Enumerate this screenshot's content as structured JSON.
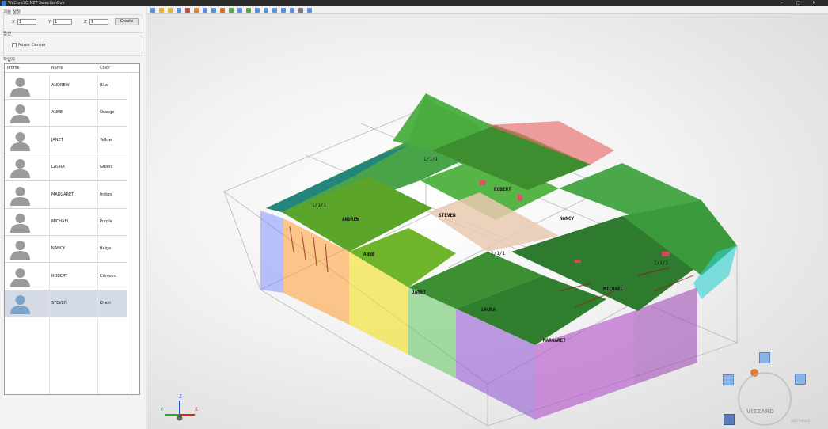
{
  "window": {
    "title": "VizCore3D.NET SelectionBox",
    "min": "–",
    "max": "▢",
    "close": "✕"
  },
  "sidebar": {
    "group_basic": "기본 설정",
    "x_label": "X",
    "x_value": "1",
    "y_label": "Y",
    "y_value": "1",
    "z_label": "Z",
    "z_value": "1",
    "create_button": "Create",
    "group_option": "옵션",
    "move_center": "Move Center",
    "group_workers": "작업자",
    "columns": [
      "Profile",
      "Name",
      "Color"
    ],
    "workers": [
      {
        "name": "ANDREW",
        "color": "Blue"
      },
      {
        "name": "ANNE",
        "color": "Orange"
      },
      {
        "name": "JANET",
        "color": "Yellow"
      },
      {
        "name": "LAURA",
        "color": "Green"
      },
      {
        "name": "MARGARET",
        "color": "Indigo"
      },
      {
        "name": "MICHAEL",
        "color": "Purple"
      },
      {
        "name": "NANCY",
        "color": "Beige"
      },
      {
        "name": "ROBERT",
        "color": "Crimson"
      },
      {
        "name": "STEVEN",
        "color": "Khaki"
      }
    ]
  },
  "viewport": {
    "block_labels": {
      "andrew": "ANDREW",
      "anne": "ANNE",
      "steven": "STEVEN",
      "robert": "ROBERT",
      "nancy": "NANCY",
      "janet": "JANET",
      "laura": "LAURA",
      "michael": "MICHAEL",
      "margaret": "MARGARET"
    },
    "rev1": "1/1/1",
    "rev2": "1/1/1",
    "rev3": "1/1/1",
    "rev4": "1/1/1",
    "axis": {
      "x": "X",
      "y": "Y",
      "z": "Z"
    },
    "brand": "VIZZARD",
    "brand_small": "SOFTHILLS",
    "accent_orange": "#e07a2c"
  }
}
